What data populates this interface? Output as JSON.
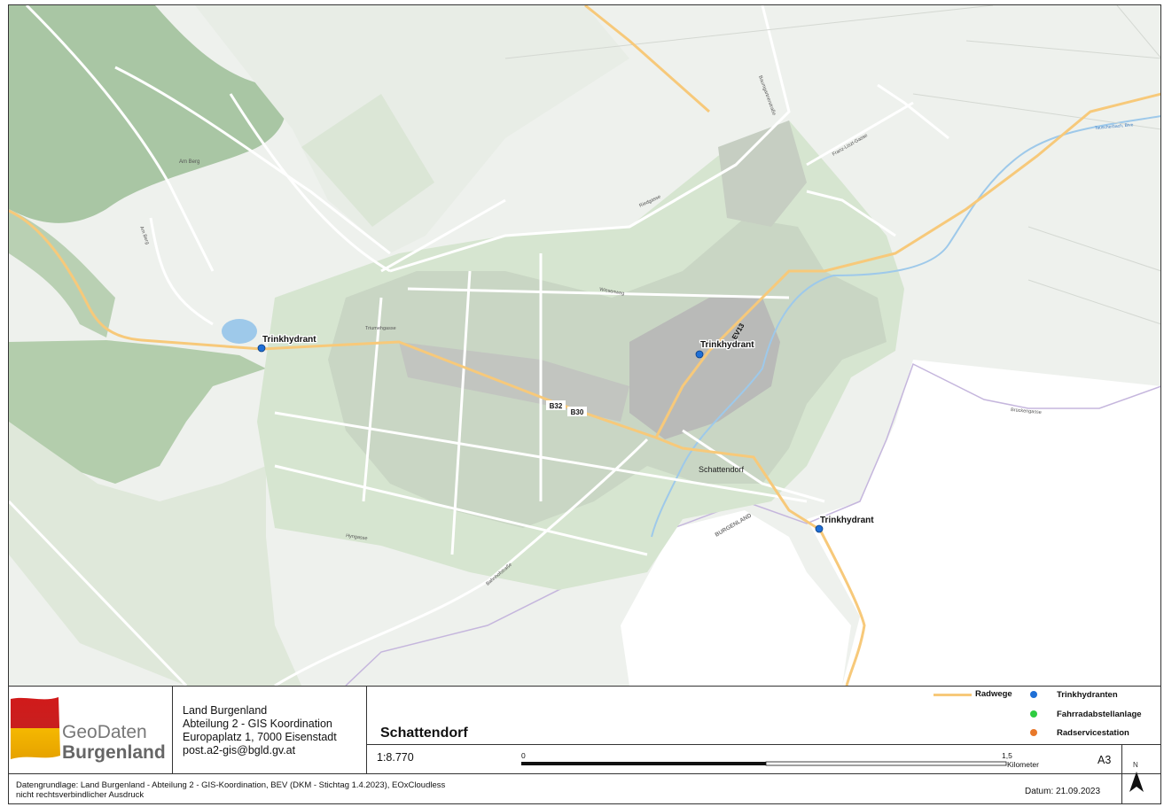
{
  "map": {
    "labels": {
      "am_berg": "Am Berg",
      "am_berg_road": "Am Berg",
      "schattendorf": "Schattendorf",
      "route_b32": "B32",
      "route_b30": "B30",
      "route_ev13": "EV13",
      "burgenland_border": "BURGENLAND",
      "weinbergstrasse": "Baumgartnerstraße",
      "riedgasse": "Riedgasse",
      "franz_liszt": "Franz-Liszt-Gasse",
      "wiesenweg": "Wiesenweg",
      "trummelgasse": "Triumehgasse",
      "hymgasse": "Hyngasse",
      "bahnhofstrasse": "Bahnhofstraße",
      "brueckengasse": "Brückengasse",
      "tauscherbach": "Tauscherbach, Bive"
    },
    "hydrants": [
      {
        "label": "Trinkhydrant"
      },
      {
        "label": "Trinkhydrant"
      },
      {
        "label": "Trinkhydrant"
      }
    ],
    "colors": {
      "background": "#eef1ed",
      "forest": "#a9c6a4",
      "meadow": "#d3e1cc",
      "built": "#b9bab8",
      "road": "#ffffff",
      "cycleway": "#f7c97a",
      "water": "#9ec9ea",
      "border": "#c5b6dd",
      "hydrant": "#1f6fd6"
    }
  },
  "footer": {
    "logo": {
      "line1": "GeoDaten",
      "line2": "Burgenland"
    },
    "org": {
      "line1": "Land Burgenland",
      "line2": "Abteilung 2 - GIS Koordination",
      "line3": "Europaplatz 1, 7000 Eisenstadt",
      "line4": "post.a2-gis@bgld.gv.at"
    },
    "title": "Schattendorf",
    "scale": "1:8.770",
    "scalebar": {
      "start": "0",
      "end": "1,5",
      "unit": "Kilometer"
    },
    "sheet_size": "A3",
    "legend": [
      {
        "label": "Radwege",
        "color": "#f7c97a",
        "kind": "line"
      },
      {
        "label": "Trinkhydranten",
        "color": "#1f6fd6",
        "kind": "dot"
      },
      {
        "label": "Fahrradabstellanlage",
        "color": "#2ecc40",
        "kind": "dot"
      },
      {
        "label": "Radservicestation",
        "color": "#e8782a",
        "kind": "dot"
      }
    ],
    "credit_line1": "Datengrundlage: Land Burgenland - Abteilung 2 - GIS-Koordination, BEV (DKM - Stichtag 1.4.2023), EOxCloudless",
    "credit_line2": "nicht rechtsverbindlicher Ausdruck",
    "date": "Datum: 21.09.2023",
    "north": "N"
  }
}
